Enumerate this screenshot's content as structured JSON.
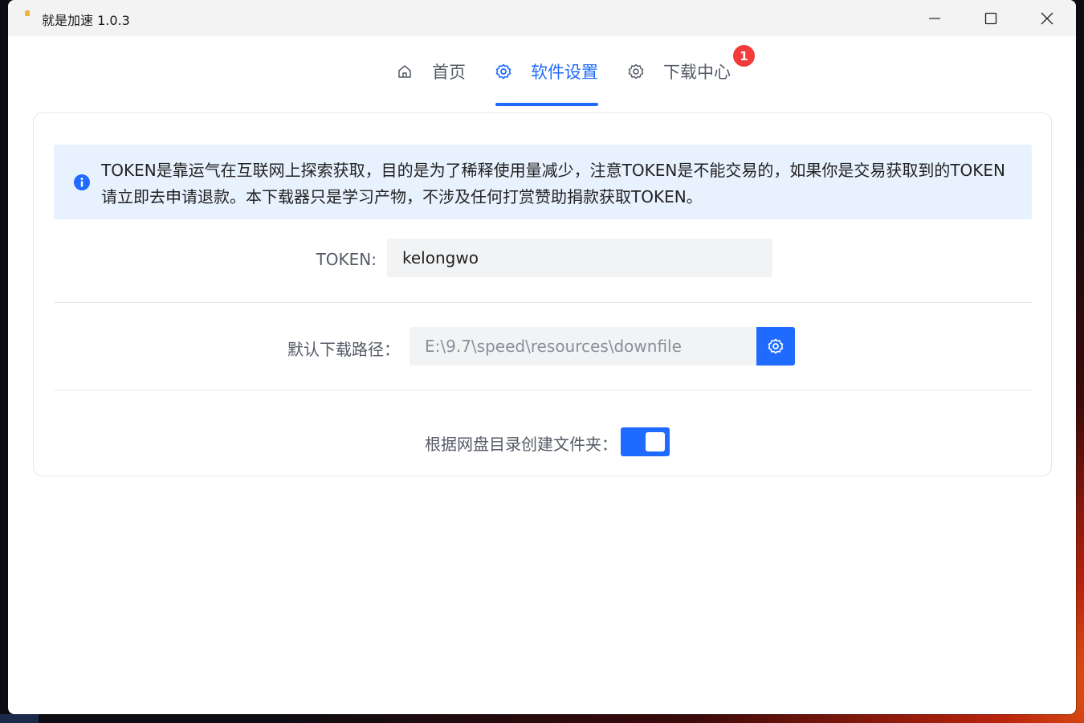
{
  "window": {
    "title": "就是加速",
    "version": "1.0.3"
  },
  "tabs": [
    {
      "label": "首页",
      "icon": "home-icon",
      "active": false
    },
    {
      "label": "软件设置",
      "icon": "gear-icon",
      "active": true
    },
    {
      "label": "下载中心",
      "icon": "gear-icon",
      "active": false,
      "badge": "1"
    }
  ],
  "notice": {
    "icon": "info-icon",
    "text": "TOKEN是靠运气在互联网上探索获取，目的是为了稀释使用量减少，注意TOKEN是不能交易的，如果你是交易获取到的TOKEN请立即去申请退款。本下载器只是学习产物，不涉及任何打赏赞助捐款获取TOKEN。"
  },
  "settings": {
    "token_label": "TOKEN:",
    "token_value": "kelongwo",
    "path_label": "默认下载路径：",
    "path_value": "E:\\9.7\\speed\\resources\\downfile",
    "folder_label": "根据网盘目录创建文件夹：",
    "folder_enabled": true
  },
  "colors": {
    "accent": "#1f6bff",
    "badge": "#f23b3b",
    "notice_bg": "#e8f2ff"
  }
}
